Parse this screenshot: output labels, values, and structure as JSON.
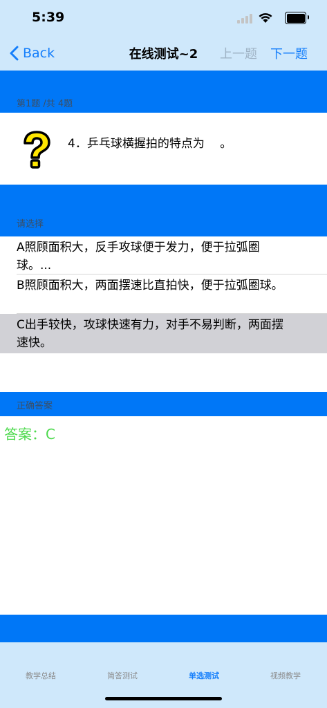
{
  "status_bar": {
    "time": "5:39"
  },
  "nav": {
    "back_label": "Back",
    "title": "在线测试~2",
    "prev_label": "上一题",
    "next_label": "下一题"
  },
  "question": {
    "progress_label": "第1题 /共 4题",
    "text": "4．乒乓球横握拍的特点为 　。"
  },
  "options_section": {
    "label": "请选择"
  },
  "options": [
    {
      "text": "A照顾面积大，反手攻球便于发力，便于拉弧圈球。...",
      "selected": false
    },
    {
      "text": "B照顾面积大，两面摆速比直拍快，便于拉弧圈球。",
      "selected": false
    },
    {
      "text": "C出手较快，攻球快速有力，对手不易判断，两面摆速快。",
      "selected": true
    }
  ],
  "answer_section": {
    "label": "正确答案",
    "answer_text": "答案：C"
  },
  "tabbar": {
    "tabs": [
      {
        "label": "教学总结",
        "active": false
      },
      {
        "label": "简答测试",
        "active": false
      },
      {
        "label": "单选测试",
        "active": true
      },
      {
        "label": "视频教学",
        "active": false
      }
    ]
  },
  "colors": {
    "nav_background": "#cfe8fb",
    "section_band": "#0077f7",
    "accent": "#147efb",
    "answer_green": "#4cd94c",
    "selected_option": "#d1d1d6"
  }
}
